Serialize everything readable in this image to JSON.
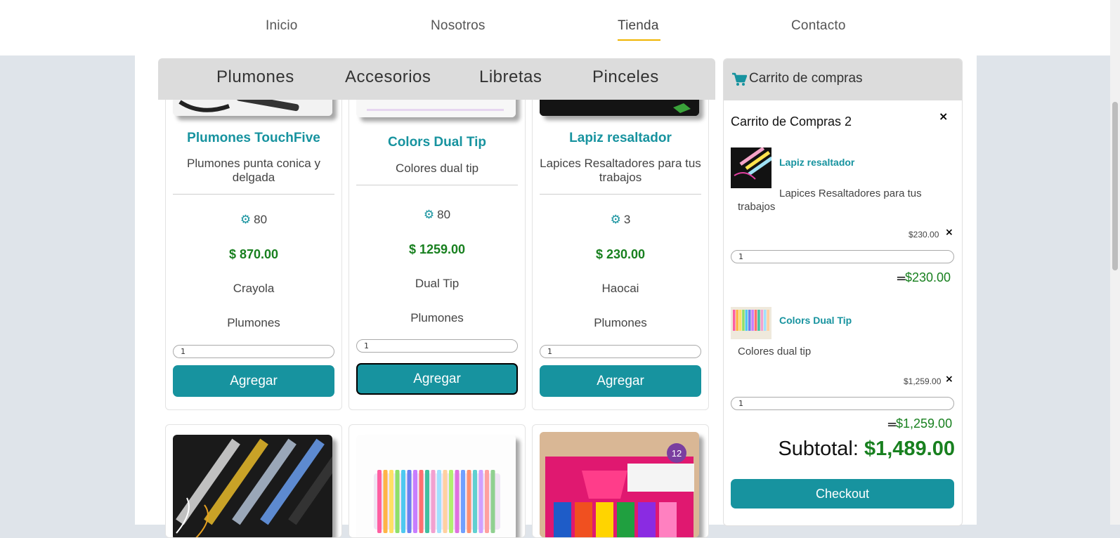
{
  "nav": {
    "items": [
      {
        "label": "Inicio"
      },
      {
        "label": "Nosotros"
      },
      {
        "label": "Tienda",
        "active": true
      },
      {
        "label": "Contacto"
      }
    ]
  },
  "categories": [
    {
      "label": "Plumones"
    },
    {
      "label": "Accesorios"
    },
    {
      "label": "Libretas"
    },
    {
      "label": "Pinceles"
    }
  ],
  "products": [
    {
      "title": "Plumones TouchFive",
      "desc": "Plumones punta conica y delgada",
      "stock": "80",
      "price": "$ 870.00",
      "brand": "Crayola",
      "category": "Plumones",
      "qty": "1",
      "button": "Agregar"
    },
    {
      "title": "Colors Dual Tip",
      "desc": "Colores dual tip",
      "stock": "80",
      "price": "$ 1259.00",
      "brand": "Dual Tip",
      "category": "Plumones",
      "qty": "1",
      "button": "Agregar"
    },
    {
      "title": "Lapiz resaltador",
      "desc": "Lapices Resaltadores para tus trabajos",
      "stock": "3",
      "price": "$ 230.00",
      "brand": "Haocai",
      "category": "Plumones",
      "qty": "1",
      "button": "Agregar"
    }
  ],
  "product_images_row2": [
    {
      "name": "metallic-markers-image"
    },
    {
      "name": "gel-pens-image"
    },
    {
      "name": "kiut-markers-image",
      "badge": "12"
    }
  ],
  "cart": {
    "header": "Carrito de compras",
    "title": "Carrito de Compras 2",
    "close": "×",
    "items": [
      {
        "name": "Lapiz resaltador",
        "desc": "Lapices Resaltadores para tus trabajos",
        "unit_price": "$230.00",
        "remove": "×",
        "qty": "1",
        "line_total": "$230.00"
      },
      {
        "name": "Colors Dual Tip",
        "desc": "Colores dual tip",
        "unit_price": "$1,259.00",
        "remove": "×",
        "qty": "1",
        "line_total": "$1,259.00"
      }
    ],
    "equals": "=",
    "subtotal_label": "Subtotal:",
    "subtotal_value": "$1,489.00",
    "checkout": "Checkout"
  },
  "colors": {
    "accent": "#17939f",
    "price_green": "#18801f",
    "nav_underline": "#f0b400",
    "bar_gray": "#dcdcdc"
  },
  "icons": {
    "stock": "gear-icon",
    "cart": "shopping-cart-icon"
  }
}
